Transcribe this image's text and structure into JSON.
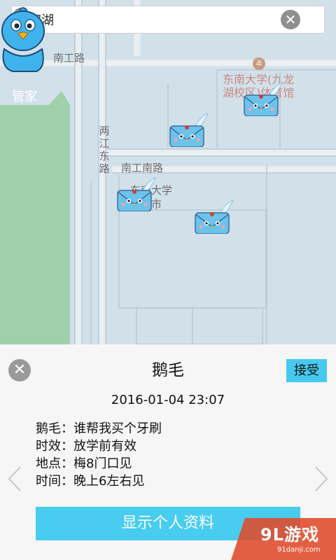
{
  "search": {
    "value": "百家湖"
  },
  "mascot": {
    "label": "管家"
  },
  "map": {
    "labels": {
      "road_nangong": "南工路",
      "road_liangjiang_east": "两江东路",
      "road_nangong_south": "南工南路",
      "poi_seu_gym": "东南大学(九龙湖校区)体育馆",
      "poi_seu_supermarket": "东南大学超超市"
    }
  },
  "panel": {
    "title": "鹅毛",
    "accept_label": "接受",
    "timestamp": "2016-01-04 23:07",
    "details": [
      "鹅毛：谁帮我买个牙刷",
      "时效：放学前有效",
      "地点：梅8门口见",
      "时间：晚上6左右见"
    ],
    "profile_button_label": "显示个人资料"
  },
  "watermark": {
    "main": "9L游戏",
    "sub": "91danji.com"
  },
  "colors": {
    "accent": "#46c9ee",
    "map_water": "#d2e0e9",
    "map_green": "#9fcfab"
  }
}
